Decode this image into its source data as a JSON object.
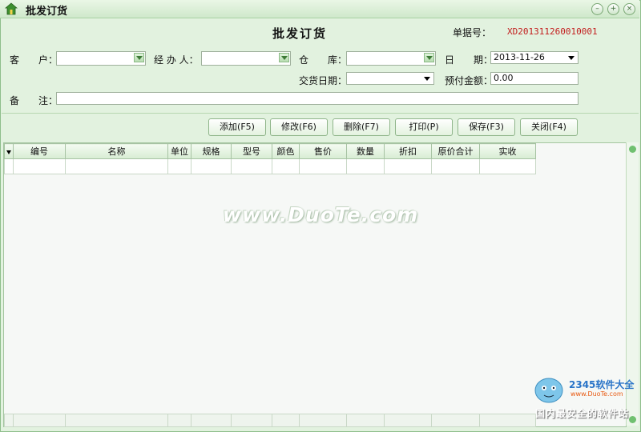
{
  "window": {
    "title": "批发订货",
    "controls": [
      "minimize-icon",
      "maximize-icon",
      "close-icon"
    ]
  },
  "header": {
    "form_title": "批发订货",
    "doc_no_label": "单据号：",
    "doc_no_value": "XD201311260010001",
    "doc_no_color": "#c21d1d"
  },
  "fields": {
    "customer_label": "客　　户：",
    "customer_value": "",
    "handler_label": "经 办 人：",
    "handler_value": "",
    "warehouse_label": "仓　　库：",
    "warehouse_value": "",
    "date_label": "日　　期：",
    "date_value": "2013-11-26",
    "delivery_date_label": "交货日期：",
    "delivery_date_value": "",
    "prepay_label": "预付金额：",
    "prepay_value": "0.00",
    "note_label": "备　　注：",
    "note_value": ""
  },
  "toolbar": {
    "add": "添加(F5)",
    "edit": "修改(F6)",
    "delete": "删除(F7)",
    "print": "打印(P)",
    "save": "保存(F3)",
    "close": "关闭(F4)"
  },
  "grid": {
    "columns": [
      "编号",
      "名称",
      "单位",
      "规格",
      "型号",
      "颜色",
      "售价",
      "数量",
      "折扣",
      "原价合计",
      "实收"
    ],
    "rows": [
      [
        "",
        "",
        "",
        "",
        "",
        "",
        "",
        "",
        "",
        "",
        ""
      ]
    ]
  },
  "overlay": {
    "watermark": "www.DuoTe.com",
    "corner_brand": "2345软件大全",
    "corner_url": "www.DuoTe.com",
    "corner_slogan": "国内最安全的软件站"
  },
  "colors": {
    "accent_green": "#70c070",
    "window_bg": "#e2f2df"
  }
}
